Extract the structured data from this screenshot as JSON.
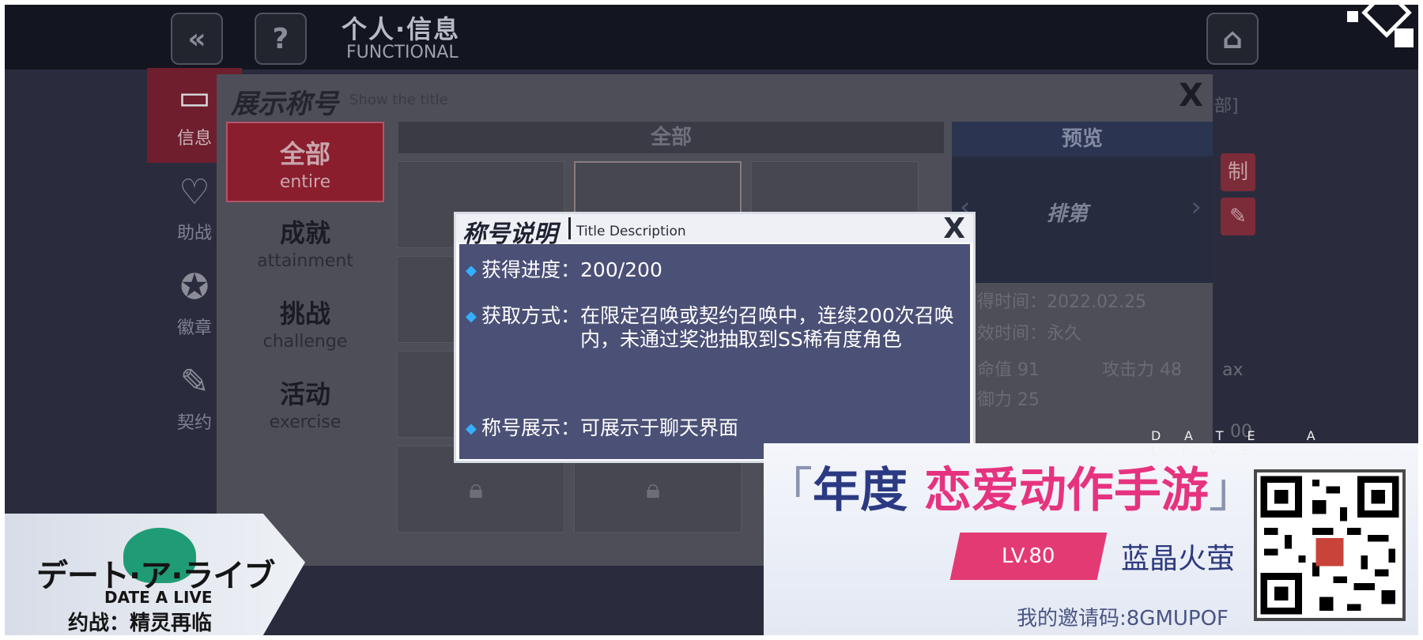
{
  "header": {
    "title": "个人·信息",
    "subtitle": "FUNCTIONAL"
  },
  "sidebar": {
    "items": [
      {
        "label": "信息"
      },
      {
        "label": "助战"
      },
      {
        "label": "徽章"
      },
      {
        "label": "契约"
      }
    ]
  },
  "panel": {
    "title": "展示称号",
    "subtitle": "Show the title",
    "close": "X",
    "tabs": [
      {
        "zh": "全部",
        "en": "entire"
      },
      {
        "zh": "成就",
        "en": "attainment"
      },
      {
        "zh": "挑战",
        "en": "challenge"
      },
      {
        "zh": "活动",
        "en": "exercise"
      }
    ],
    "list_header": "全部",
    "preview_header": "预览",
    "preview_badge": "排第",
    "right_tab_partial": "部]",
    "info": {
      "obtain_time": "得时间：2022.02.25",
      "valid_time": "效时间：永久",
      "hp": "命值 91",
      "atk": "攻击力 48",
      "def": "御力 25",
      "max_partial": "ax",
      "num_partial": "00"
    }
  },
  "dialog": {
    "title": "称号说明",
    "subtitle": "Title Description",
    "close": "X",
    "rows": [
      {
        "label": "获得进度：",
        "value": "200/200"
      },
      {
        "label": "获取方式：",
        "value": "在限定召唤或契约召唤中，连续200次召唤内，未通过奖池抽取到SS稀有度角色"
      },
      {
        "label": "称号展示：",
        "value": "可展示于聊天界面"
      }
    ]
  },
  "promo": {
    "tagline": "DATE A LIVE",
    "slogan_open": "「",
    "slogan_blue": "年度 ",
    "slogan_pink": "恋爱动作手游",
    "slogan_close": "」",
    "level": "LV.80",
    "nickname": "蓝晶火萤",
    "invite": "我的邀请码:8GMUPOF"
  },
  "logo": {
    "jp": "デート·ア·ライブ",
    "en": "DATE A LIVE",
    "cn": "约战：精灵再临"
  },
  "colors": {
    "accent_pink": "#e43a74",
    "dialog_body": "#4b5076",
    "slogan_blue": "#2b3a82"
  }
}
